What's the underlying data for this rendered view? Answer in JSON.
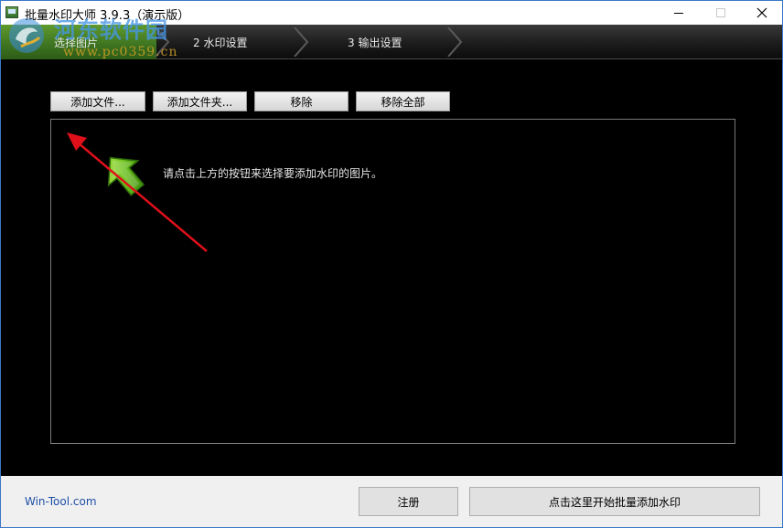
{
  "window": {
    "title": "批量水印大师 3.9.3（演示版）"
  },
  "steps": [
    {
      "label": "选择图片"
    },
    {
      "label": "2 水印设置"
    },
    {
      "label": "3 输出设置"
    }
  ],
  "watermark": {
    "title": "河东软件园",
    "url": "www.pc0359.cn"
  },
  "toolbar": {
    "add_file": "添加文件...",
    "add_folder": "添加文件夹...",
    "remove": "移除",
    "remove_all": "移除全部"
  },
  "list": {
    "hint": "请点击上方的按钮来选择要添加水印的图片。",
    "hint_icon": "green-up-arrow-icon"
  },
  "footer": {
    "link": "Win-Tool.com",
    "register": "注册",
    "start": "点击这里开始批量添加水印"
  },
  "colors": {
    "step_active": "#4a8a25",
    "annotation_arrow": "#e0101a",
    "footer_link": "#1f4fa8"
  }
}
